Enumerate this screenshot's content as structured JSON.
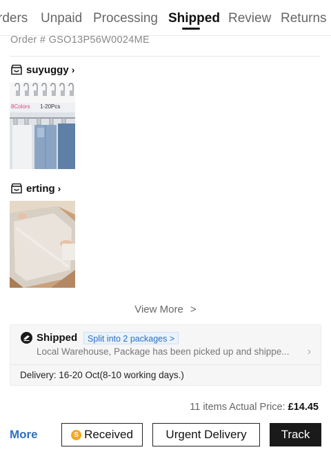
{
  "tabs": [
    {
      "label": "rders",
      "active": false
    },
    {
      "label": "Unpaid",
      "active": false
    },
    {
      "label": "Processing",
      "active": false
    },
    {
      "label": "Shipped",
      "active": true
    },
    {
      "label": "Review",
      "active": false
    },
    {
      "label": "Returns",
      "active": false
    }
  ],
  "order": {
    "number_text": "Order # GSO13P56W0024ME"
  },
  "stores": [
    {
      "name": "suyuggy",
      "icon": "store-icon",
      "product": {
        "image_text_1": "8Colors",
        "image_text_2": "1-20Pcs"
      }
    },
    {
      "name": "erting",
      "icon": "store-icon",
      "product": {}
    }
  ],
  "view_more": {
    "label": "View More",
    "chevron": ">"
  },
  "shipment": {
    "title": "Shipped",
    "split_label": "Split into 2 packages >",
    "description": "Local Warehouse, Package has been picked up and shippe...",
    "delivery": "Delivery: 16-20 Oct(8-10 working days.)"
  },
  "summary": {
    "items_label": "11 items Actual Price:",
    "price": "£14.45"
  },
  "actions": {
    "more": "More",
    "received": "Received",
    "received_coin": "S",
    "urgent": "Urgent Delivery",
    "track": "Track"
  },
  "colors": {
    "link": "#2f6fc2",
    "badge_text": "#2b6fc1",
    "coin": "#f5a623",
    "dark_button": "#1a1a1a"
  }
}
